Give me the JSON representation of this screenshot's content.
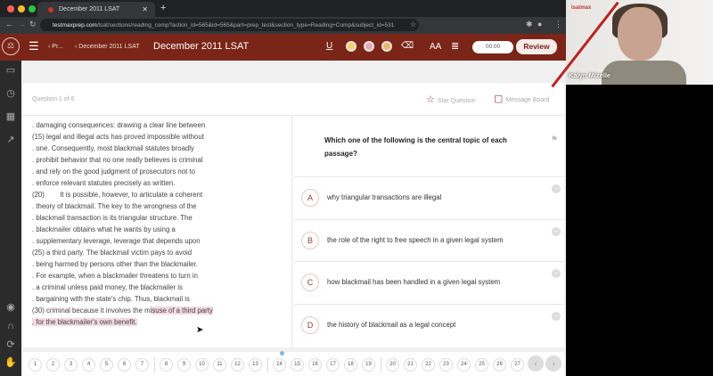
{
  "browser": {
    "tab_title": "December 2011 LSAT",
    "url_domain": "testmaxprep.com",
    "url_path": "/lsat/sections/reading_comp?action_id=565&id=565&part=prep_test&section_type=Reading+Comp&subject_id=531"
  },
  "topbar": {
    "crumb1": "‹ Pr...",
    "crumb2": "‹ December 2011 LSAT",
    "title": "December 2011 LSAT",
    "timer": "00:00",
    "review": "Review",
    "font_size": "AA"
  },
  "question": {
    "counter": "Question 1 of 6",
    "star": "Star Question",
    "message_board": "Message Board",
    "text": "Which one of the following is the central topic of each passage?"
  },
  "passage": {
    "lines": [
      ". damaging consequences: drawing a clear line between",
      "(15) legal and illegal acts has proved impossible without",
      ". one. Consequently, most blackmail statutes broadly",
      ". prohibit behavior that no one really believes is criminal",
      ". and rely on the good judgment of prosecutors not to",
      ". enforce relevant statutes precisely as written.",
      "(20)        It is possible, however, to articulate a coherent",
      ". theory of blackmail. The key to the wrongness of the",
      ". blackmail transaction is its triangular structure. The",
      ". blackmailer obtains what he wants by using a",
      ". supplementary leverage, leverage that depends upon",
      "(25) a third party. The blackmail victim pays to avoid",
      ". being harmed by persons other than the blackmailer.",
      ". For example, when a blackmailer threatens to turn in",
      ". a criminal unless paid money, the blackmailer is",
      ". bargaining with the state's chip. Thus, blackmail is"
    ],
    "line30_plain": "(30) criminal because it involves the m",
    "line30_hl": "isuse of a third party",
    "line31_hl": ". for the blackmailer's own benefit."
  },
  "answers": [
    {
      "letter": "A",
      "text": "why triangular transactions are illegal"
    },
    {
      "letter": "B",
      "text": "the role of the right to free speech in a given legal system"
    },
    {
      "letter": "C",
      "text": "how blackmail has been handled in a given legal system"
    },
    {
      "letter": "D",
      "text": "the history of blackmail as a legal concept"
    }
  ],
  "qnav": {
    "numbers": [
      "1",
      "2",
      "3",
      "4",
      "5",
      "6",
      "7",
      "8",
      "9",
      "10",
      "11",
      "12",
      "13",
      "14",
      "15",
      "16",
      "17",
      "18",
      "19",
      "20",
      "21",
      "22",
      "23",
      "24",
      "25",
      "26",
      "27"
    ],
    "current": "14"
  },
  "video": {
    "name": "Kalyn Mizelle",
    "brand": "lsatmax"
  }
}
